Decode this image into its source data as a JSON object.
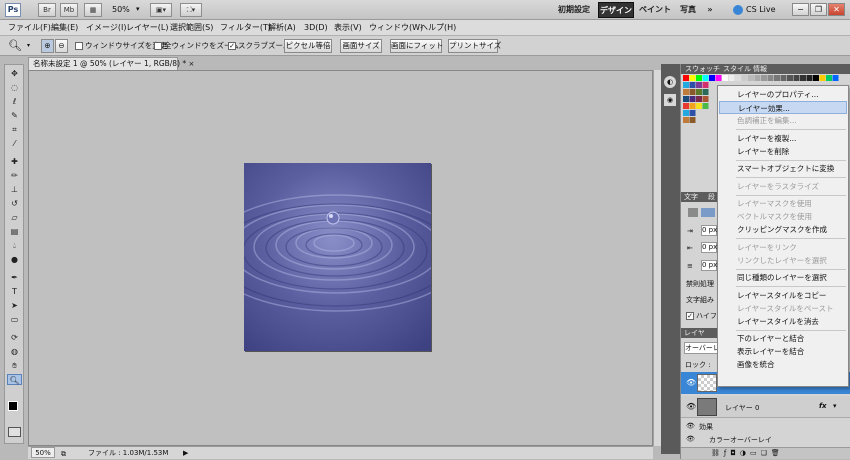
{
  "app": {
    "logo": "Ps",
    "zoom": "50%"
  },
  "titlebar": {
    "br_label": "Br",
    "mb_label": "Mb",
    "workspaces": [
      "初期設定",
      "デザイン",
      "ペイント",
      "写真"
    ],
    "more": "»",
    "cslive": "CS Live"
  },
  "menus": [
    "ファイル(F)",
    "編集(E)",
    "イメージ(I)",
    "レイヤー(L)",
    "選択範囲(S)",
    "フィルター(T)",
    "解析(A)",
    "3D(D)",
    "表示(V)",
    "ウィンドウ(W)",
    "ヘルプ(H)"
  ],
  "options": {
    "resize_windows": "ウィンドウサイズを変更",
    "zoom_all": "全ウィンドウをズーム",
    "scrubby_zoom": "スクラブズーム",
    "actual_pixels": "ピクセル等倍",
    "screen_size": "画面サイズ",
    "fit_screen": "画面にフィット",
    "print_size": "プリントサイズ"
  },
  "document": {
    "tab_title": "名称未設定 1 @ 50% (レイヤー 1, RGB/8) *",
    "status_zoom": "50%",
    "status_file": "ファイル : 1.03M/1.53M"
  },
  "panels": {
    "swatches_tabs": [
      "スウォッチ",
      "スタイル",
      "情報"
    ],
    "char_tabs": [
      "文字",
      "段"
    ],
    "zero_px": "0 px",
    "prohibit": "禁則処理",
    "composer": "文字組み",
    "hyphenate": "ハイフ",
    "layers_tab": "レイヤ",
    "blend_mode": "オーバーレ",
    "lock": "ロック :",
    "layer0": "レイヤー 0",
    "fx": "fx",
    "effects": "効果",
    "color_overlay": "カラーオーバーレイ"
  },
  "context_menu": [
    {
      "label": "レイヤーのプロパティ...",
      "enabled": true
    },
    {
      "label": "レイヤー効果...",
      "enabled": true,
      "highlighted": true
    },
    {
      "label": "色調補正を編集...",
      "enabled": false
    },
    {
      "sep": true
    },
    {
      "label": "レイヤーを複製...",
      "enabled": true
    },
    {
      "label": "レイヤーを削除",
      "enabled": true
    },
    {
      "sep": true
    },
    {
      "label": "スマートオブジェクトに変換",
      "enabled": true
    },
    {
      "sep": true
    },
    {
      "label": "レイヤーをラスタライズ",
      "enabled": false
    },
    {
      "sep": true
    },
    {
      "label": "レイヤーマスクを使用",
      "enabled": false
    },
    {
      "label": "ベクトルマスクを使用",
      "enabled": false
    },
    {
      "label": "クリッピングマスクを作成",
      "enabled": true
    },
    {
      "sep": true
    },
    {
      "label": "レイヤーをリンク",
      "enabled": false
    },
    {
      "label": "リンクしたレイヤーを選択",
      "enabled": false
    },
    {
      "sep": true
    },
    {
      "label": "同じ種類のレイヤーを選択",
      "enabled": true
    },
    {
      "sep": true
    },
    {
      "label": "レイヤースタイルをコピー",
      "enabled": true
    },
    {
      "label": "レイヤースタイルをペースト",
      "enabled": false
    },
    {
      "label": "レイヤースタイルを消去",
      "enabled": true
    },
    {
      "sep": true
    },
    {
      "label": "下のレイヤーと結合",
      "enabled": true
    },
    {
      "label": "表示レイヤーを結合",
      "enabled": true
    },
    {
      "label": "画像を統合",
      "enabled": true
    }
  ],
  "colors": {
    "accent_blue": "#3a86d6",
    "ripple": "#5a5f9e",
    "workspace_active": "#333333"
  }
}
